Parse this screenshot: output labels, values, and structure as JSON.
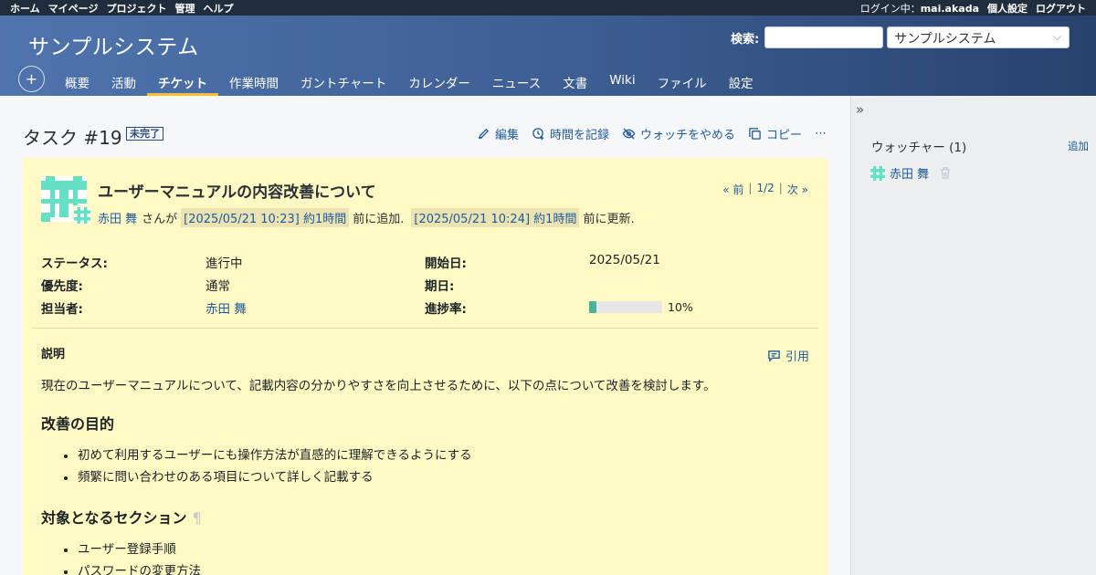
{
  "top_menu": {
    "left_items": [
      "ホーム",
      "マイページ",
      "プロジェクト",
      "管理",
      "ヘルプ"
    ],
    "login_label": "ログイン中：",
    "username": "mai.akada",
    "my_account": "個人設定",
    "logout": "ログアウト"
  },
  "header": {
    "project_title": "サンプルシステム",
    "search_label": "検索:",
    "search_value": "",
    "project_jump": "サンプルシステム"
  },
  "main_menu": {
    "new_icon": "plus-icon",
    "tabs": [
      {
        "label": "概要",
        "selected": false
      },
      {
        "label": "活動",
        "selected": false
      },
      {
        "label": "チケット",
        "selected": true
      },
      {
        "label": "作業時間",
        "selected": false
      },
      {
        "label": "ガントチャート",
        "selected": false
      },
      {
        "label": "カレンダー",
        "selected": false
      },
      {
        "label": "ニュース",
        "selected": false
      },
      {
        "label": "文書",
        "selected": false
      },
      {
        "label": "Wiki",
        "selected": false
      },
      {
        "label": "ファイル",
        "selected": false
      },
      {
        "label": "設定",
        "selected": false
      }
    ]
  },
  "issue": {
    "title": "タスク #19",
    "status_badge": "未完了",
    "actions": {
      "edit": "編集",
      "log_time": "時間を記録",
      "unwatch": "ウォッチをやめる",
      "copy": "コピー",
      "more": "⋯"
    },
    "subject": "ユーザーマニュアルの内容改善について",
    "nav": {
      "prev": "« 前",
      "sep": "|",
      "position": "1/2",
      "next": "次 »"
    },
    "author_line": {
      "author": "赤田 舞",
      "by": "さんが",
      "created": "[2025/05/21 10:23] 約1時間",
      "created_suffix": "前に追加.",
      "updated": "[2025/05/21 10:24] 約1時間",
      "updated_suffix": "前に更新."
    },
    "attributes": {
      "status_label": "ステータス:",
      "status": "進行中",
      "priority_label": "優先度:",
      "priority": "通常",
      "assignee_label": "担当者:",
      "assignee": "赤田 舞",
      "start_label": "開始日:",
      "start": "2025/05/21",
      "due_label": "期日:",
      "due": "",
      "progress_label": "進捗率:",
      "progress": "10%",
      "progress_value": 0.1
    },
    "description": {
      "heading": "説明",
      "quote": "引用",
      "intro": "現在のユーザーマニュアルについて、記載内容の分かりやすさを向上させるために、以下の点について改善を検討します。",
      "goal_heading": "改善の目的",
      "goals": [
        "初めて利用するユーザーにも操作方法が直感的に理解できるようにする",
        "頻繁に問い合わせのある項目について詳しく記載する"
      ],
      "sections_heading": "対象となるセクション",
      "pilcrow": "¶",
      "sections": [
        "ユーザー登録手順",
        "パスワードの変更方法"
      ]
    }
  },
  "sidebar": {
    "toggle": "»",
    "watchers_heading": "ウォッチャー (1)",
    "add": "追加",
    "watchers": [
      "赤田 舞"
    ]
  },
  "colors": {
    "accent": "#f2c037",
    "issue_bg": "#fff9c4",
    "link": "#1f5a9c",
    "progress": "#4bb19a"
  }
}
